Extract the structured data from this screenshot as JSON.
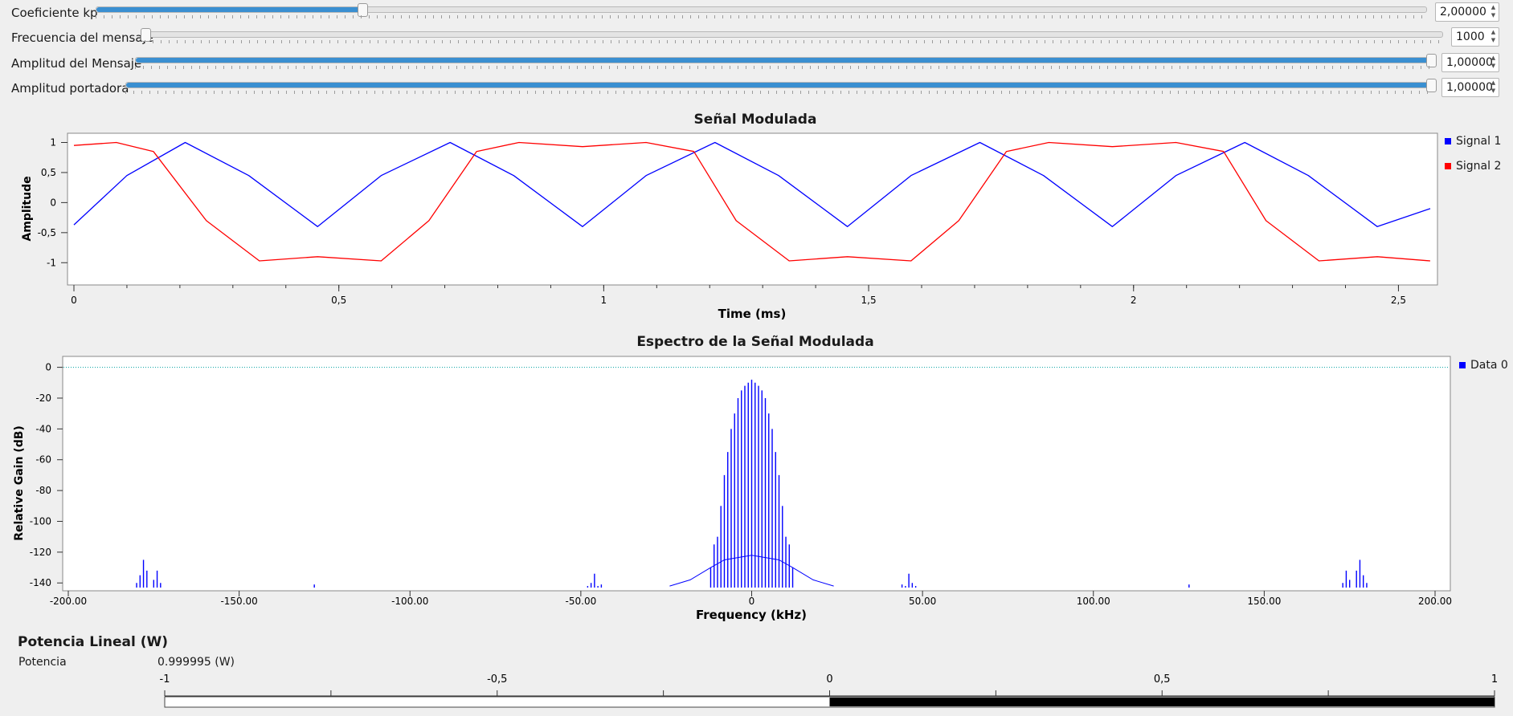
{
  "sliders": [
    {
      "label": "Coeficiente kp",
      "value": "2,00000",
      "fraction": 0.2
    },
    {
      "label": "Frecuencia del mensaje",
      "value": "1000",
      "fraction": 0.0
    },
    {
      "label": "Amplitud del Mensaje",
      "value": "1,00000",
      "fraction": 1.0
    },
    {
      "label": "Amplitud portadora",
      "value": "1,00000",
      "fraction": 1.0
    }
  ],
  "time_plot": {
    "title": "Señal Modulada",
    "xlabel": "Time (ms)",
    "ylabel": "Amplitude",
    "legend": [
      {
        "name": "Signal 1",
        "color": "#0000ff"
      },
      {
        "name": "Signal 2",
        "color": "#ff0000"
      }
    ]
  },
  "freq_plot": {
    "title": "Espectro de la Señal Modulada",
    "xlabel": "Frequency (kHz)",
    "ylabel": "Relative Gain (dB)",
    "legend": [
      {
        "name": "Data 0",
        "color": "#0000ff"
      }
    ]
  },
  "power": {
    "title": "Potencia Lineal (W)",
    "label": "Potencia",
    "value": "0.999995 (W)",
    "level": 0.999995
  },
  "chart_data": [
    {
      "type": "line",
      "title": "Señal Modulada",
      "xlabel": "Time (ms)",
      "ylabel": "Amplitude",
      "xlim": [
        0,
        2.56
      ],
      "ylim": [
        -1.25,
        1.1
      ],
      "xticks": [
        0,
        0.5,
        1,
        1.5,
        2,
        2.5
      ],
      "xtick_labels": [
        "0",
        "0,5",
        "1",
        "1,5",
        "2",
        "2,5"
      ],
      "yticks": [
        1,
        0.5,
        0,
        -0.5,
        -1
      ],
      "ytick_labels": [
        "1",
        "0,5",
        "0",
        "-0,5",
        "-1"
      ],
      "legend_position": "right",
      "series": [
        {
          "name": "Signal 1",
          "color": "#0000ff",
          "x": [
            0,
            0.1,
            0.21,
            0.33,
            0.46,
            0.58,
            0.71,
            0.83,
            0.96,
            1.08,
            1.21,
            1.33,
            1.46,
            1.58,
            1.71,
            1.83,
            1.96,
            2.08,
            2.21,
            2.33,
            2.46,
            2.56
          ],
          "y": [
            -0.37,
            0.45,
            1.0,
            0.45,
            -0.4,
            0.45,
            1.0,
            0.45,
            -0.4,
            0.45,
            1.0,
            0.45,
            -0.4,
            0.45,
            1.0,
            0.45,
            -0.4,
            0.45,
            1.0,
            0.45,
            -0.4,
            -0.1
          ]
        },
        {
          "name": "Signal 2",
          "color": "#ff0000",
          "x": [
            0,
            0.08,
            0.15,
            0.25,
            0.35,
            0.46,
            0.58,
            0.67,
            0.76,
            0.84,
            0.96,
            1.08,
            1.17,
            1.25,
            1.35,
            1.46,
            1.58,
            1.67,
            1.76,
            1.84,
            1.96,
            2.08,
            2.17,
            2.25,
            2.35,
            2.46,
            2.56
          ],
          "y": [
            0.95,
            1.0,
            0.85,
            -0.3,
            -0.97,
            -0.9,
            -0.97,
            -0.3,
            0.85,
            1.0,
            0.93,
            1.0,
            0.85,
            -0.3,
            -0.97,
            -0.9,
            -0.97,
            -0.3,
            0.85,
            1.0,
            0.93,
            1.0,
            0.85,
            -0.3,
            -0.97,
            -0.9,
            -0.97
          ]
        }
      ]
    },
    {
      "type": "line",
      "title": "Espectro de la Señal Modulada",
      "xlabel": "Frequency (kHz)",
      "ylabel": "Relative Gain (dB)",
      "xlim": [
        -200,
        200
      ],
      "ylim": [
        -143,
        5
      ],
      "xticks": [
        -200,
        -150,
        -100,
        -50,
        0,
        50,
        100,
        150,
        200
      ],
      "xtick_labels": [
        "-200.00",
        "-150.00",
        "-100.00",
        "-50.00",
        "0",
        "50.00",
        "100.00",
        "150.00",
        "200.00"
      ],
      "yticks": [
        0,
        -20,
        -40,
        -60,
        -80,
        -100,
        -120,
        -140
      ],
      "ytick_labels": [
        "0",
        "-20",
        "-40",
        "-60",
        "-80",
        "-100",
        "-120",
        "-140"
      ],
      "legend_position": "right",
      "reference_line": {
        "y": 0,
        "color": "#00a0a0",
        "style": "dotted"
      },
      "series": [
        {
          "name": "Data 0",
          "color": "#0000ff",
          "peaks_x": [
            -12,
            -11,
            -10,
            -9,
            -8,
            -7,
            -6,
            -5,
            -4,
            -3,
            -2,
            -1,
            0,
            1,
            2,
            3,
            4,
            5,
            6,
            7,
            8,
            9,
            10,
            11,
            12,
            -180,
            -179,
            -178,
            -177,
            -175,
            -174,
            -173,
            -48,
            -47,
            -46,
            -45,
            -44,
            44,
            45,
            46,
            47,
            48,
            173,
            174,
            175,
            177,
            178,
            179,
            180,
            -128,
            128
          ],
          "peaks_y": [
            -130,
            -115,
            -110,
            -90,
            -70,
            -55,
            -40,
            -30,
            -20,
            -15,
            -12,
            -10,
            -8,
            -10,
            -12,
            -15,
            -20,
            -30,
            -40,
            -55,
            -70,
            -90,
            -110,
            -115,
            -130,
            -140,
            -135,
            -125,
            -132,
            -138,
            -132,
            -140,
            -142,
            -140,
            -134,
            -142,
            -141,
            -141,
            -142,
            -134,
            -140,
            -142,
            -140,
            -132,
            -138,
            -132,
            -125,
            -135,
            -140,
            -141,
            -141
          ],
          "baseline_x": [
            -24,
            -18,
            -12,
            -8,
            0,
            8,
            12,
            18,
            24
          ],
          "baseline_y": [
            -142,
            -138,
            -130,
            -125,
            -122,
            -125,
            -130,
            -138,
            -142
          ]
        }
      ]
    }
  ]
}
